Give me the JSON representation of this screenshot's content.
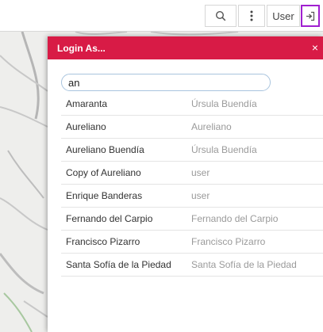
{
  "toolbar": {
    "search_icon": "⌕",
    "more_icon": "⋮",
    "user_label": "User",
    "logout_icon": "⇥"
  },
  "dialog": {
    "title": "Login As...",
    "close_icon": "×",
    "search_value": "an",
    "rows": [
      {
        "name": "Amaranta",
        "user": "Úrsula Buendía"
      },
      {
        "name": "Aureliano",
        "user": "Aureliano"
      },
      {
        "name": "Aureliano Buendía",
        "user": "Úrsula Buendía"
      },
      {
        "name": "Copy of Aureliano",
        "user": "user"
      },
      {
        "name": "Enrique Banderas",
        "user": "user"
      },
      {
        "name": "Fernando del Carpio",
        "user": "Fernando del Carpio"
      },
      {
        "name": "Francisco Pizarro",
        "user": "Francisco Pizarro"
      },
      {
        "name": "Santa Sofía de la Piedad",
        "user": "Santa Sofía de la Piedad"
      }
    ]
  },
  "colors": {
    "header": "#d81b46",
    "logout_border": "#a020d0"
  }
}
